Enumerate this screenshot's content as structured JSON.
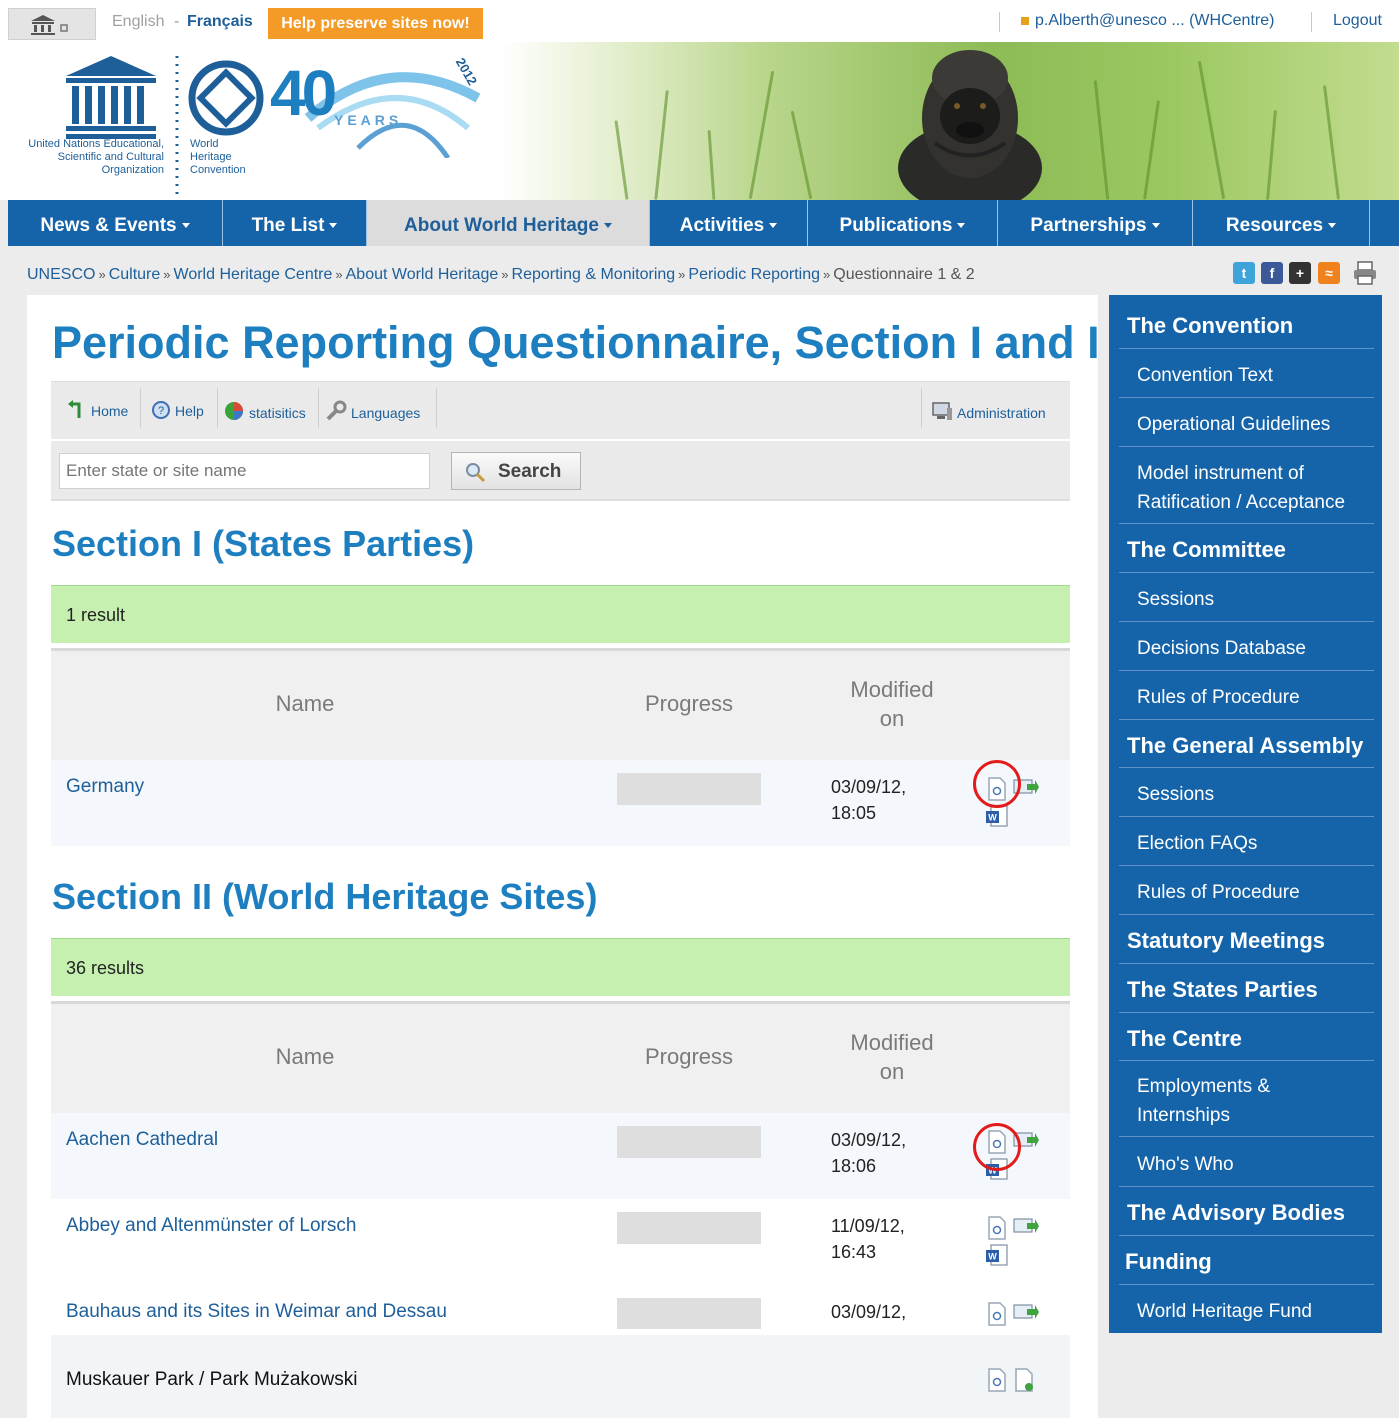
{
  "topbar": {
    "lang_en": "English",
    "lang_sep": "-",
    "lang_fr": "Français",
    "help_button": "Help preserve sites now!",
    "user": "p.Alberth@unesco ... (WHCentre)",
    "logout": "Logout"
  },
  "banner": {
    "unesco_lines": "United Nations Educational, Scientific and Cultural Organization",
    "whc_line1": "World",
    "whc_line2": "Heritage",
    "whc_line3": "Convention",
    "years": "YEARS",
    "year": "2012",
    "anniversary": "40"
  },
  "nav": [
    {
      "label": "News & Events"
    },
    {
      "label": "The List"
    },
    {
      "label": "About World Heritage"
    },
    {
      "label": "Activities"
    },
    {
      "label": "Publications"
    },
    {
      "label": "Partnerships"
    },
    {
      "label": "Resources"
    }
  ],
  "breadcrumb": [
    "UNESCO",
    "Culture",
    "World Heritage Centre",
    "About World Heritage",
    "Reporting & Monitoring",
    "Periodic Reporting",
    "Questionnaire 1 & 2"
  ],
  "breadcrumb_sep": "»",
  "page_title": "Periodic Reporting Questionnaire, Section I and II",
  "toolbar": {
    "home": "Home",
    "help": "Help",
    "statistics": "statisitics",
    "languages": "Languages",
    "administration": "Administration"
  },
  "search": {
    "placeholder": "Enter state or site name",
    "button": "Search"
  },
  "table_headers": {
    "name": "Name",
    "progress": "Progress",
    "modified_line1": "Modified",
    "modified_line2": "on"
  },
  "section1": {
    "title": "Section I (States Parties)",
    "results": "1 result",
    "rows": [
      {
        "name": "Germany",
        "date": "03/09/12,",
        "time": "18:05"
      }
    ]
  },
  "section2": {
    "title": "Section II (World Heritage Sites)",
    "results": "36 results",
    "rows": [
      {
        "name": "Aachen Cathedral",
        "date": "03/09/12,",
        "time": "18:06"
      },
      {
        "name": "Abbey and Altenmünster of Lorsch",
        "date": "11/09/12,",
        "time": "16:43"
      },
      {
        "name": "Bauhaus and its Sites in Weimar and Dessau",
        "date": "03/09/12,",
        "time": ""
      },
      {
        "name": "Muskauer Park / Park Mużakowski",
        "date": "",
        "time": ""
      }
    ]
  },
  "sidebar": {
    "convention": "The Convention",
    "convention_text": "Convention Text",
    "operational_guidelines": "Operational Guidelines",
    "model_instrument_1": "Model instrument of",
    "model_instrument_2": "Ratification / Acceptance",
    "committee": "The Committee",
    "committee_sessions": "Sessions",
    "decisions_db": "Decisions Database",
    "committee_rules": "Rules of Procedure",
    "general_assembly": "The General Assembly",
    "ga_sessions": "Sessions",
    "election_faqs": "Election FAQs",
    "ga_rules": "Rules of Procedure",
    "statutory": "Statutory Meetings",
    "states_parties": "The States Parties",
    "centre": "The Centre",
    "employments_1": "Employments &",
    "employments_2": "Internships",
    "whos_who": "Who's Who",
    "advisory": "The Advisory Bodies",
    "funding": "Funding",
    "wh_fund": "World Heritage Fund"
  },
  "colors": {
    "nav_blue": "#1564aa",
    "title_blue": "#1e7fc0",
    "link_blue": "#1e5f9a",
    "result_green": "#c5f0b0",
    "help_orange": "#f39a27",
    "highlight_red": "#e21b1b"
  }
}
